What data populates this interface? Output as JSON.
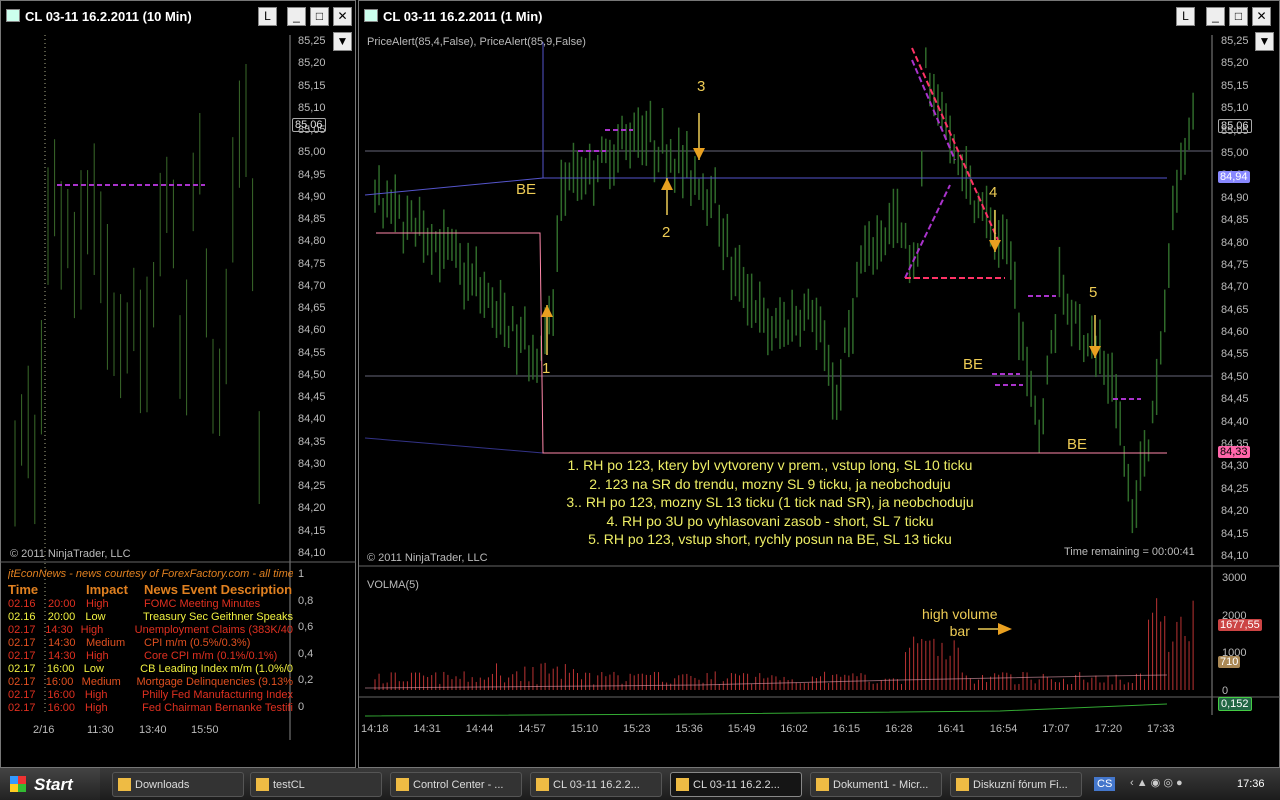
{
  "left_window": {
    "title": "CL 03-11  16.2.2011 (10 Min)",
    "copyright": "© 2011 NinjaTrader, LLC",
    "price_ticks": [
      "85,25",
      "85,20",
      "85,15",
      "85,10",
      "85,05",
      "85,00",
      "84,95",
      "84,90",
      "84,85",
      "84,80",
      "84,75",
      "84,70",
      "84,65",
      "84,60",
      "84,55",
      "84,50",
      "84,45",
      "84,40",
      "84,35",
      "84,30",
      "84,25",
      "84,20",
      "84,15",
      "84,10"
    ],
    "current_price": "85,06",
    "indicator_ticks": [
      "1",
      "0,8",
      "0,6",
      "0,4",
      "0,2",
      "0"
    ],
    "time_ticks": [
      "2/16",
      "11:30",
      "13:40",
      "15:50"
    ],
    "closes": [
      84.35,
      84.38,
      84.4,
      84.33,
      84.5,
      84.85,
      84.9,
      84.85,
      84.8,
      84.75,
      84.82,
      84.9,
      84.88,
      84.8,
      84.7,
      84.6,
      84.55,
      84.6,
      84.65,
      84.55,
      84.6,
      84.7,
      84.85,
      84.9,
      84.8,
      84.55,
      84.6,
      84.9,
      85.0,
      84.7,
      84.5,
      84.45,
      84.6,
      84.9,
      85.05,
      85.1,
      84.8,
      84.3
    ]
  },
  "news": {
    "header": "jtEconNews - news courtesy of ForexFactory.com - all times are",
    "columns": [
      "Time",
      "Impact",
      "News Event Description"
    ],
    "rows": [
      {
        "date": "02.16",
        "time": "20:00",
        "impact": "High",
        "event": "FOMC Meeting Minutes",
        "color": "#e03020"
      },
      {
        "date": "02.16",
        "time": "20:00",
        "impact": "Low",
        "event": "Treasury Sec Geithner Speaks",
        "color": "#f0f040"
      },
      {
        "date": "02.17",
        "time": "14:30",
        "impact": "High",
        "event": "Unemployment Claims (383K/40",
        "color": "#e03020"
      },
      {
        "date": "02.17",
        "time": "14:30",
        "impact": "Medium",
        "event": "CPI m/m (0.5%/0.3%)",
        "color": "#e05020"
      },
      {
        "date": "02.17",
        "time": "14:30",
        "impact": "High",
        "event": "Core CPI m/m (0.1%/0.1%)",
        "color": "#e03020"
      },
      {
        "date": "02.17",
        "time": "16:00",
        "impact": "Low",
        "event": "CB Leading Index m/m (1.0%/0",
        "color": "#f0f040"
      },
      {
        "date": "02.17",
        "time": "16:00",
        "impact": "Medium",
        "event": "Mortgage Delinquencies (9.13%",
        "color": "#e05020"
      },
      {
        "date": "02.17",
        "time": "16:00",
        "impact": "High",
        "event": "Philly Fed Manufacturing Index",
        "color": "#e03020"
      },
      {
        "date": "02.17",
        "time": "16:00",
        "impact": "High",
        "event": "Fed Chairman Bernanke Testifi",
        "color": "#e03020"
      }
    ]
  },
  "main_window": {
    "title": "CL 03-11  16.2.2011 (1 Min)",
    "indicator_label": "PriceAlert(85,4,False), PriceAlert(85,9,False)",
    "copyright": "© 2011 NinjaTrader, LLC",
    "time_remaining": "Time remaining = 00:00:41",
    "price_ticks": [
      "85,25",
      "85,20",
      "85,15",
      "85,10",
      "85,05",
      "85,00",
      "84,95",
      "84,90",
      "84,85",
      "84,80",
      "84,75",
      "84,70",
      "84,65",
      "84,60",
      "84,55",
      "84,50",
      "84,45",
      "84,40",
      "84,35",
      "84,30",
      "84,25",
      "84,20",
      "84,15",
      "84,10"
    ],
    "current_price": "85,06",
    "blue_level": "84,94",
    "pink_level": "84,33",
    "time_ticks": [
      "14:18",
      "14:31",
      "14:44",
      "14:57",
      "15:10",
      "15:23",
      "15:36",
      "15:49",
      "16:02",
      "16:15",
      "16:28",
      "16:41",
      "16:54",
      "17:07",
      "17:20",
      "17:33"
    ],
    "path": [
      [
        0,
        84.9
      ],
      [
        6,
        84.86
      ],
      [
        16,
        84.8
      ],
      [
        26,
        84.7
      ],
      [
        36,
        84.58
      ],
      [
        40,
        84.55
      ],
      [
        44,
        84.65
      ],
      [
        46,
        84.92
      ],
      [
        58,
        85.0
      ],
      [
        65,
        85.05
      ],
      [
        73,
        85.0
      ],
      [
        83,
        84.92
      ],
      [
        88,
        84.75
      ],
      [
        98,
        84.6
      ],
      [
        108,
        84.65
      ],
      [
        114,
        84.45
      ],
      [
        120,
        84.75
      ],
      [
        128,
        84.85
      ],
      [
        134,
        84.75
      ],
      [
        136,
        85.2
      ],
      [
        143,
        85.0
      ],
      [
        148,
        84.9
      ],
      [
        157,
        84.78
      ],
      [
        159,
        84.6
      ],
      [
        164,
        84.38
      ],
      [
        169,
        84.7
      ],
      [
        174,
        84.6
      ],
      [
        179,
        84.55
      ],
      [
        183,
        84.45
      ],
      [
        187,
        84.2
      ],
      [
        193,
        84.45
      ],
      [
        198,
        84.95
      ],
      [
        202,
        85.08
      ]
    ],
    "notes": [
      "1. RH po 123, ktery byl vytvoreny v prem., vstup long, SL 10 ticku",
      "2. 123 na SR do trendu, mozny SL 9 ticku, ja neobchoduju",
      "3.. RH po 123, mozny SL 13 ticku (1 tick nad SR), ja neobchoduju",
      "4. RH po 3U po vyhlasovani zasob - short, SL 7 ticku",
      "5. RH po 123, vstup short, rychly posun na BE, SL 13 ticku"
    ],
    "labels": {
      "n1": "1",
      "n2": "2",
      "n3": "3",
      "n4": "4",
      "n5": "5",
      "be1": "BE",
      "be2": "BE",
      "be3": "BE"
    },
    "volume": {
      "label": "VOLMA(5)",
      "ticks": [
        "3000",
        "2000",
        "1000",
        "0"
      ],
      "current": "1677,55",
      "ma": "710",
      "annotation": "high volume",
      "annotation2": "bar"
    },
    "bottom_value": "0,152"
  },
  "taskbar": {
    "start": "Start",
    "items": [
      "Downloads",
      "testCL",
      "Control Center - ...",
      "CL 03-11  16.2.2...",
      "CL 03-11  16.2.2...",
      "Dokument1 - Micr...",
      "Diskuzní fórum Fi..."
    ],
    "lang": "CS",
    "clock": "17:36"
  }
}
